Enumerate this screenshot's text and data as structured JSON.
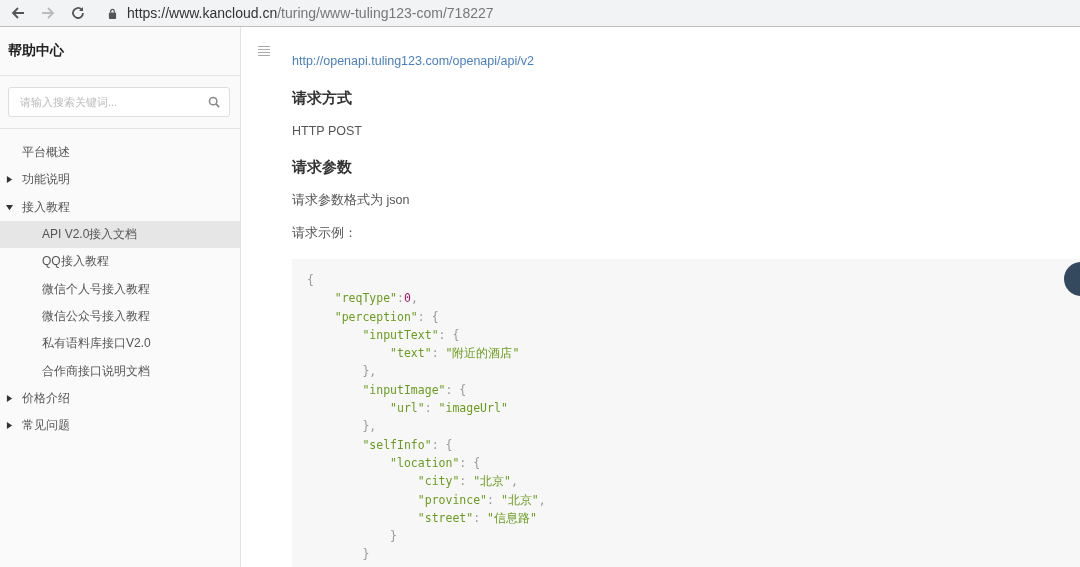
{
  "browser": {
    "url_host": "https://www.kancloud.cn",
    "url_path": "/turing/www-tuling123-com/718227"
  },
  "sidebar": {
    "title": "帮助中心",
    "search": {
      "placeholder": "请输入搜索关键词..."
    },
    "items": [
      {
        "label": "平台概述",
        "kind": "page",
        "selected": false
      },
      {
        "label": "功能说明",
        "kind": "group",
        "expanded": false,
        "selected": false
      },
      {
        "label": "接入教程",
        "kind": "group",
        "expanded": true,
        "selected": false,
        "children": [
          {
            "label": "API V2.0接入文档",
            "selected": true
          },
          {
            "label": "QQ接入教程",
            "selected": false
          },
          {
            "label": "微信个人号接入教程",
            "selected": false
          },
          {
            "label": "微信公众号接入教程",
            "selected": false
          },
          {
            "label": "私有语料库接口V2.0",
            "selected": false
          },
          {
            "label": "合作商接口说明文档",
            "selected": false
          }
        ]
      },
      {
        "label": "价格介绍",
        "kind": "group",
        "expanded": false,
        "selected": false
      },
      {
        "label": "常见问题",
        "kind": "group",
        "expanded": false,
        "selected": false
      }
    ]
  },
  "content": {
    "blocks": [
      {
        "kind": "link",
        "text": "http://openapi.tuling123.com/openapi/api/v2"
      },
      {
        "kind": "heading",
        "text": "请求方式"
      },
      {
        "kind": "paragraph",
        "text": "HTTP POST"
      },
      {
        "kind": "heading",
        "text": "请求参数"
      },
      {
        "kind": "paragraph",
        "text": "请求参数格式为 json"
      },
      {
        "kind": "paragraph",
        "text": "请求示例："
      },
      {
        "kind": "code",
        "lines": [
          "{",
          "    \"reqType\":0,",
          "    \"perception\": {",
          "        \"inputText\": {",
          "            \"text\": \"附近的酒店\"",
          "        },",
          "        \"inputImage\": {",
          "            \"url\": \"imageUrl\"",
          "        },",
          "        \"selfInfo\": {",
          "            \"location\": {",
          "                \"city\": \"北京\",",
          "                \"province\": \"北京\",",
          "                \"street\": \"信息路\"",
          "            }",
          "        }"
        ]
      }
    ]
  }
}
